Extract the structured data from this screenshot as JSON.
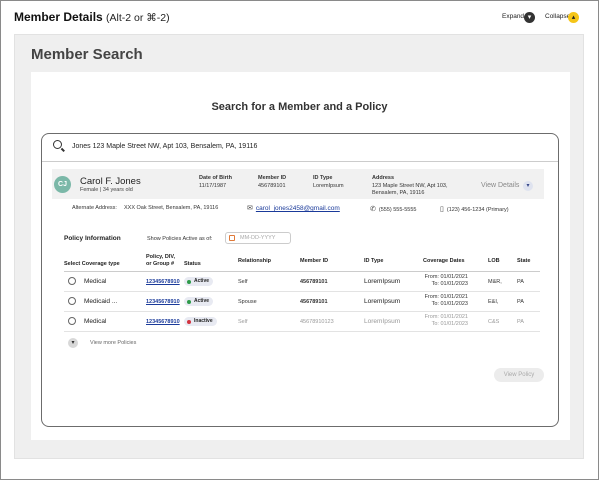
{
  "header": {
    "title": "Member Details",
    "shortcut": "(Alt-2 or ⌘-2)",
    "expand_label": "Expand",
    "collapse_label": "Collapse"
  },
  "section_title": "Member Search",
  "search": {
    "heading": "Search for a Member and a Policy",
    "value": "Jones  123 Maple Street NW, Apt 103, Bensalem, PA, 19116"
  },
  "member": {
    "initials": "CJ",
    "name": "Carol F. Jones",
    "sub": "Female | 34 years old",
    "dob_label": "Date of Birth",
    "dob": "11/17/1987",
    "member_id_label": "Member ID",
    "member_id": "456789101",
    "id_type_label": "ID Type",
    "id_type": "LoremIpsum",
    "address_label": "Address",
    "address_line1": "123 Maple Street NW, Apt 103,",
    "address_line2": "Bensalem, PA, 19116",
    "view_details": "View Details",
    "alt_address_label": "Alternate Address:",
    "alt_address": "XXX Oak Street, Bensalem, PA, 19116",
    "email": "carol_jones2458@gmail.com",
    "phone1": "(555) 555-5555",
    "phone2": "(123) 456-1234  (Primary)"
  },
  "policy": {
    "title": "Policy Information",
    "show_active_label": "Show Policies Active as of:",
    "date_placeholder": "MM-DD-YYYY",
    "columns": {
      "coverage": "Select Coverage type",
      "policy_1": "Policy, DIV,",
      "policy_2": "or Group #",
      "status": "Status",
      "relationship": "Relationship",
      "member_id": "Member ID",
      "id_type": "ID Type",
      "coverage_dates": "Coverage Dates",
      "lob": "LOB",
      "state": "State"
    },
    "rows": [
      {
        "coverage": "Medical",
        "policy": "12345678910",
        "status": "Active",
        "relationship": "Self",
        "member_id": "456789101",
        "id_type": "LoremIpsum",
        "from_label": "From:",
        "from": "01/01/2021",
        "to_label": "To:",
        "to": "01/01/2023",
        "lob": "M&R,",
        "state": "PA"
      },
      {
        "coverage": "Medicaid ...",
        "policy": "12345678910",
        "status": "Active",
        "relationship": "Spouse",
        "member_id": "456789101",
        "id_type": "LoremIpsum",
        "from_label": "From:",
        "from": "01/01/2021",
        "to_label": "To:",
        "to": "01/01/2023",
        "lob": "E&I,",
        "state": "PA"
      },
      {
        "coverage": "Medical",
        "policy": "12345678910",
        "status": "Inactive",
        "relationship": "Self",
        "member_id": "45678910123",
        "id_type": "LoremIpsum",
        "from_label": "From:",
        "from": "01/01/2021",
        "to_label": "To:",
        "to": "01/01/2023",
        "lob": "C&S",
        "state": "PA"
      }
    ],
    "view_more": "View more Policies"
  },
  "view_policy_button": "View Policy",
  "colors": {
    "accent_yellow": "#f5c518",
    "link_blue": "#1a3a9a",
    "active_green": "#2e9a4a",
    "inactive_red": "#d2333f",
    "avatar_teal": "#7bb8a8"
  }
}
